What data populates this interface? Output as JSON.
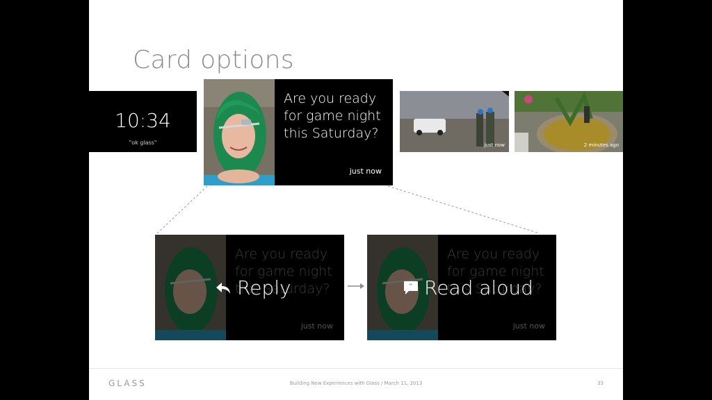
{
  "slide": {
    "title": "Card options"
  },
  "clock_card": {
    "time": "10:34",
    "hint": "\"ok glass\""
  },
  "main_card": {
    "message": "Are you ready for game night this Saturday?",
    "time": "just now"
  },
  "thumbnails": [
    {
      "time": "just now"
    },
    {
      "time": "2 minutes ago"
    }
  ],
  "options": [
    {
      "label": "Reply",
      "icon": "reply-icon",
      "message": "Are you ready for game night this Saturday?",
      "time": "just now"
    },
    {
      "label": "Read aloud",
      "icon": "speech-bubble-icon",
      "message": "Are you ready for game night this Saturday?",
      "time": "just now"
    }
  ],
  "footer": {
    "logo": "GLASS",
    "caption": "Building New Experiences with Glass  /  March 11, 2013",
    "page": "33"
  },
  "colors": {
    "background": "#ffffff",
    "card": "#000000",
    "title": "#8a8a8a"
  }
}
